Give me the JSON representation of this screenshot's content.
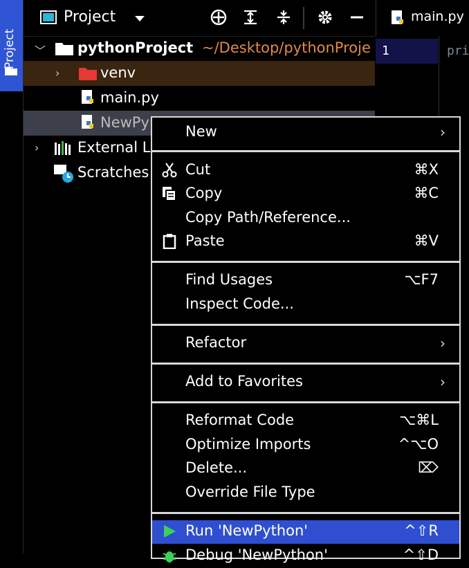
{
  "sidebar": {
    "tab_label": "Project"
  },
  "header": {
    "title": "Project"
  },
  "editor": {
    "tab_name": "main.py",
    "line_number": "1",
    "code_start": "pri"
  },
  "tree": {
    "root_name": "pythonProject",
    "root_path": "~/Desktop/pythonProje",
    "venv": "venv",
    "main": "main.py",
    "newpython": "NewPy",
    "external": "External L",
    "scratches": "Scratches"
  },
  "menu": {
    "new": "New",
    "cut": "Cut",
    "cut_sc": "⌘X",
    "copy": "Copy",
    "copy_sc": "⌘C",
    "copy_path": "Copy Path/Reference...",
    "paste": "Paste",
    "paste_sc": "⌘V",
    "find_usages": "Find Usages",
    "find_usages_sc": "⌥F7",
    "inspect": "Inspect Code...",
    "refactor": "Refactor",
    "add_fav": "Add to Favorites",
    "reformat": "Reformat Code",
    "reformat_sc": "⌥⌘L",
    "optimize": "Optimize Imports",
    "optimize_sc": "^⌥O",
    "delete": "Delete...",
    "delete_sc": "⌦",
    "override": "Override File Type",
    "run": "Run 'NewPython'",
    "run_sc": "^⇧R",
    "debug": "Debug 'NewPython'",
    "debug_sc": "^⇧D"
  },
  "colors": {
    "accent": "#2f4fd0",
    "path": "#e0894a",
    "venv_row": "#3a2510",
    "selected_row": "#3d3f4a"
  }
}
